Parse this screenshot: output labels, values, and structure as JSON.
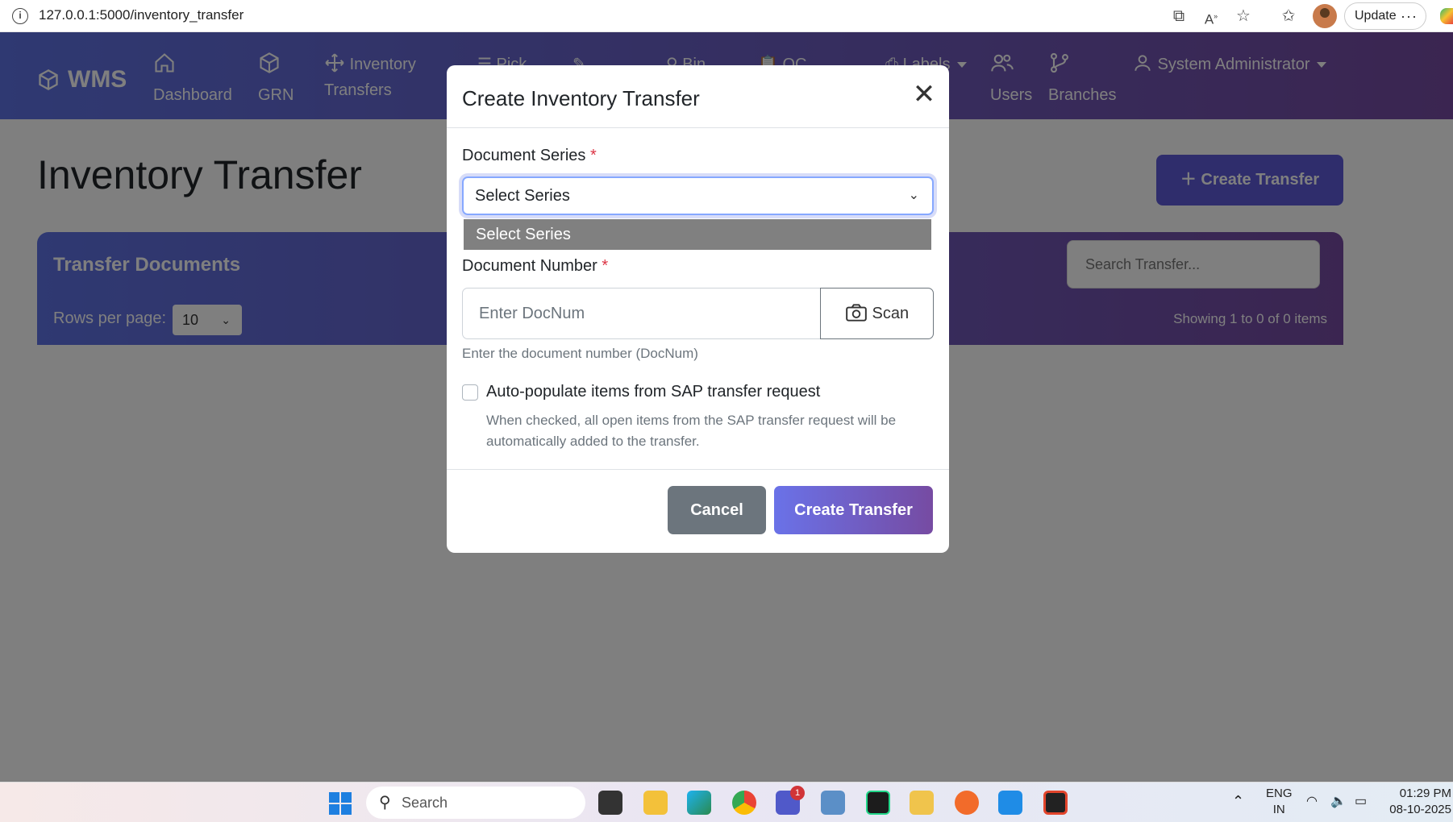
{
  "browser": {
    "url": "127.0.0.1:5000/inventory_transfer",
    "update_label": "Update",
    "more_label": "···"
  },
  "navbar": {
    "brand": "WMS",
    "items": [
      {
        "icon": "home-icon",
        "label1": "",
        "label2": "Dashboard"
      },
      {
        "icon": "box-icon",
        "label1": "",
        "label2": "GRN"
      },
      {
        "icon": "move-icon",
        "label1": "Inventory",
        "label2": "Transfers"
      },
      {
        "icon": "list-icon",
        "label1": "Pick",
        "label2": ""
      },
      {
        "icon": "search-icon",
        "label1": "Bin",
        "label2": ""
      },
      {
        "icon": "clipboard-icon",
        "label1": "QC",
        "label2": ""
      },
      {
        "icon": "printer-icon",
        "label1": "Labels",
        "label2": ""
      },
      {
        "icon": "users-icon",
        "label1": "",
        "label2": "Users"
      },
      {
        "icon": "branch-icon",
        "label1": "",
        "label2": "Branches"
      }
    ],
    "user": "System Administrator"
  },
  "page": {
    "title": "Inventory Transfer",
    "create_button": "Create Transfer",
    "card_title": "Transfer Documents",
    "rows_label": "Rows per page:",
    "rows_value": "10",
    "search_placeholder": "Search Transfer...",
    "showing_text": "Showing 1 to 0 of 0 items"
  },
  "modal": {
    "title": "Create Inventory Transfer",
    "series_label": "Document Series",
    "series_value": "Select Series",
    "series_options": [
      "Select Series"
    ],
    "required_mark": "*",
    "docnum_label": "Document Number",
    "docnum_placeholder": "Enter DocNum",
    "scan_label": "Scan",
    "docnum_help": "Enter the document number (DocNum)",
    "autopopulate_label": "Auto-populate items from SAP transfer request",
    "autopopulate_checked": false,
    "autopopulate_desc": "When checked, all open items from the SAP transfer request will be automatically added to the transfer.",
    "cancel_label": "Cancel",
    "submit_label": "Create Transfer"
  },
  "taskbar": {
    "search_label": "Search",
    "teams_badge": "1",
    "lang_line1": "ENG",
    "lang_line2": "IN",
    "time": "01:29 PM",
    "date": "08-10-2025"
  }
}
